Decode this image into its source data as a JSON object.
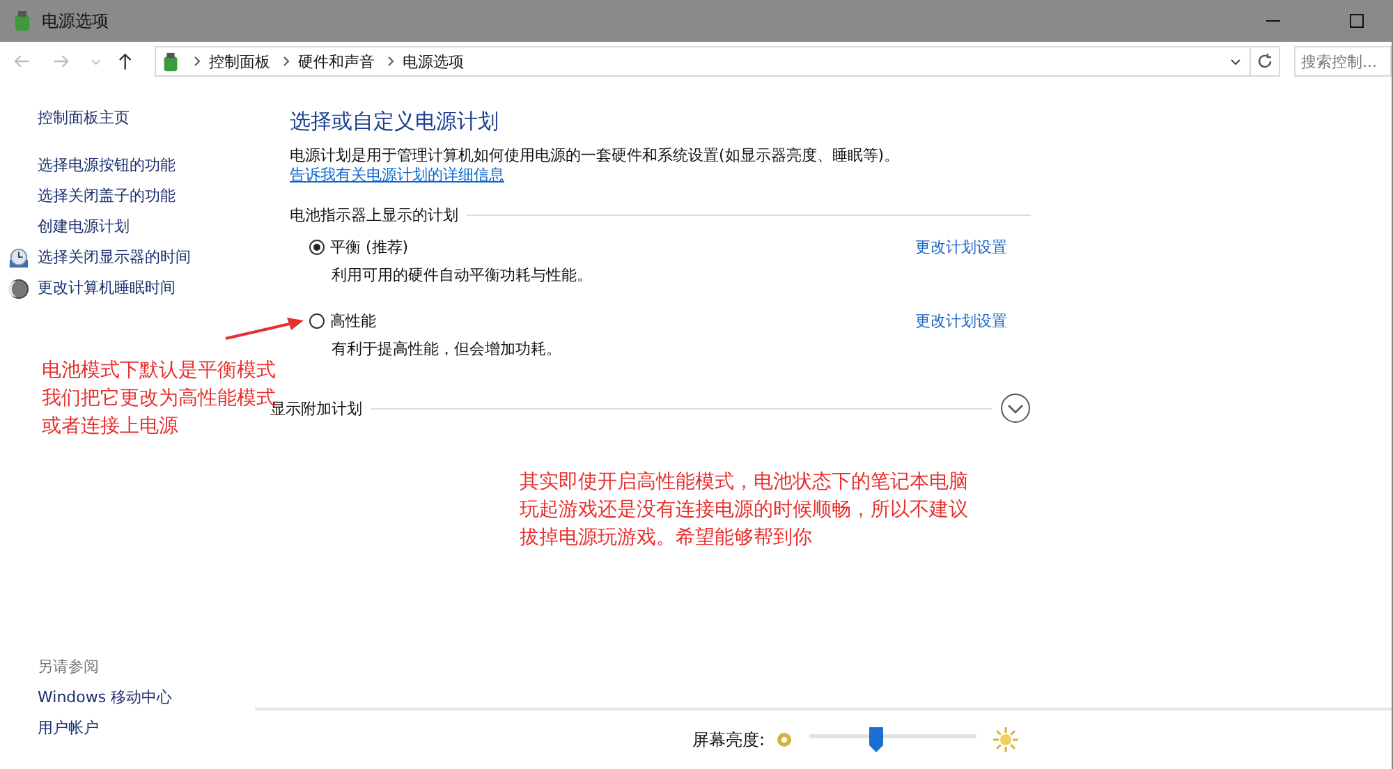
{
  "window": {
    "title": "电源选项"
  },
  "address_bar": {
    "path": [
      "控制面板",
      "硬件和声音",
      "电源选项"
    ]
  },
  "search": {
    "placeholder": "搜索控制..."
  },
  "sidebar": {
    "home": "控制面板主页",
    "items": [
      {
        "label": "选择电源按钮的功能",
        "kind": "plain"
      },
      {
        "label": "选择关闭盖子的功能",
        "kind": "plain"
      },
      {
        "label": "创建电源计划",
        "kind": "plain"
      },
      {
        "label": "选择关闭显示器的时间",
        "kind": "display"
      },
      {
        "label": "更改计算机睡眠时间",
        "kind": "sleep"
      }
    ],
    "see_also": {
      "heading": "另请参阅",
      "links": [
        "Windows 移动中心",
        "用户帐户"
      ]
    }
  },
  "main": {
    "title": "选择或自定义电源计划",
    "description": "电源计划是用于管理计算机如何使用电源的一套硬件和系统设置(如显示器亮度、睡眠等)。",
    "link": "告诉我有关电源计划的详细信息",
    "group": "电池指示器上显示的计划",
    "plans": [
      {
        "name": "平衡 (推荐)",
        "description": "利用可用的硬件自动平衡功耗与性能。",
        "selected": true,
        "action": "更改计划设置"
      },
      {
        "name": "高性能",
        "description": "有利于提高性能，但会增加功耗。",
        "selected": false,
        "action": "更改计划设置"
      }
    ],
    "additional": "显示附加计划"
  },
  "brightness": {
    "label": "屏幕亮度:",
    "level": 0.4
  },
  "annotations": [
    {
      "lines": [
        "电池模式下默认是平衡模式",
        "我们把它更改为高性能模式",
        "或者连接上电源"
      ]
    },
    {
      "lines": [
        "其实即使开启高性能模式，电池状态下的笔记本电脑",
        "玩起游戏还是没有连接电源的时候顺畅，所以不建议",
        "拔掉电源玩游戏。希望能够帮到你"
      ]
    }
  ]
}
